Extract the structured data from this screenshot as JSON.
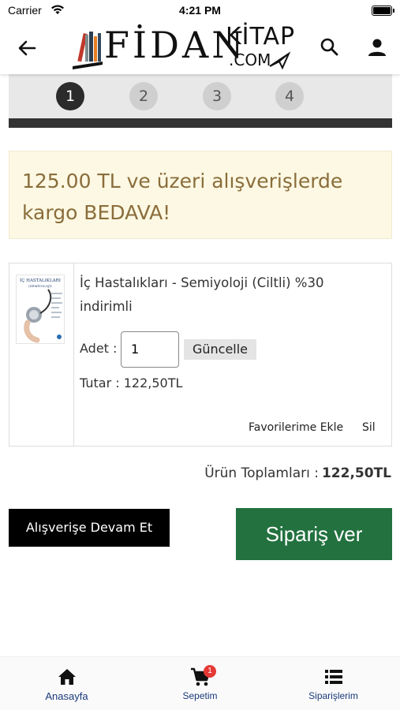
{
  "status_bar": {
    "carrier": "Carrier",
    "time": "4:21 PM"
  },
  "header": {
    "logo": {
      "fidan": "FİDAN",
      "kitap": "KİTAP",
      "com": ".COM"
    },
    "back_icon": "arrow-left-icon",
    "search_icon": "search-icon",
    "user_icon": "user-icon"
  },
  "steps": [
    "1",
    "2",
    "3",
    "4"
  ],
  "active_step": 1,
  "promo": {
    "text": "125.00 TL ve üzeri alışverişlerde kargo BEDAVA!"
  },
  "cart_item": {
    "title": "İç Hastalıkları - Semiyoloji (Ciltli) %30 indirimli",
    "cover_title": "İÇ HASTALIKLARI",
    "cover_subtitle": "(SEMİYOLOJİ)",
    "qty_label": "Adet :",
    "qty_value": "1",
    "update_label": "Güncelle",
    "total_text": "Tutar : 122,50TL",
    "favorite_label": "Favorilerime Ekle",
    "delete_label": "Sil"
  },
  "summary": {
    "label": "Ürün Toplamları :",
    "amount": "122,50TL"
  },
  "actions": {
    "continue_label": "Alışverişe Devam Et",
    "order_label": "Sipariş ver"
  },
  "tabbar": {
    "items": [
      {
        "label": "Anasayfa",
        "icon": "home-icon"
      },
      {
        "label": "Sepetim",
        "icon": "cart-icon",
        "badge": "1"
      },
      {
        "label": "Siparişlerim",
        "icon": "list-icon"
      }
    ]
  },
  "colors": {
    "order_green": "#22713f",
    "promo_bg": "#fcf8e3",
    "promo_text": "#8a6d3b",
    "tab_blue": "#1a3a7a",
    "badge_red": "#e53935"
  }
}
